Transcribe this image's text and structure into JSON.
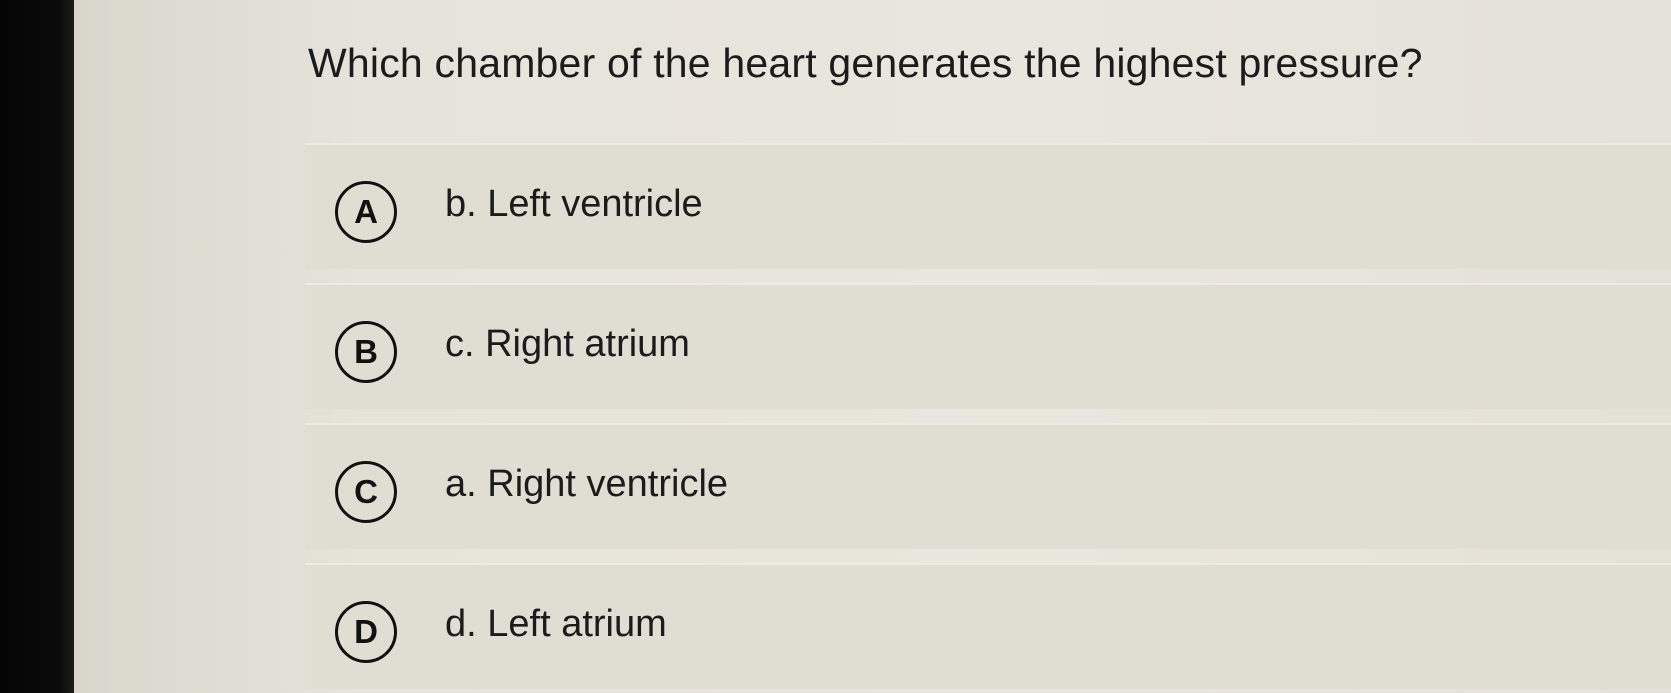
{
  "question": {
    "text": "Which chamber of the heart generates the highest pressure?"
  },
  "options": [
    {
      "letter": "A",
      "text": "b. Left ventricle"
    },
    {
      "letter": "B",
      "text": "c. Right atrium"
    },
    {
      "letter": "C",
      "text": "a. Right ventricle"
    },
    {
      "letter": "D",
      "text": "d. Left atrium"
    }
  ]
}
